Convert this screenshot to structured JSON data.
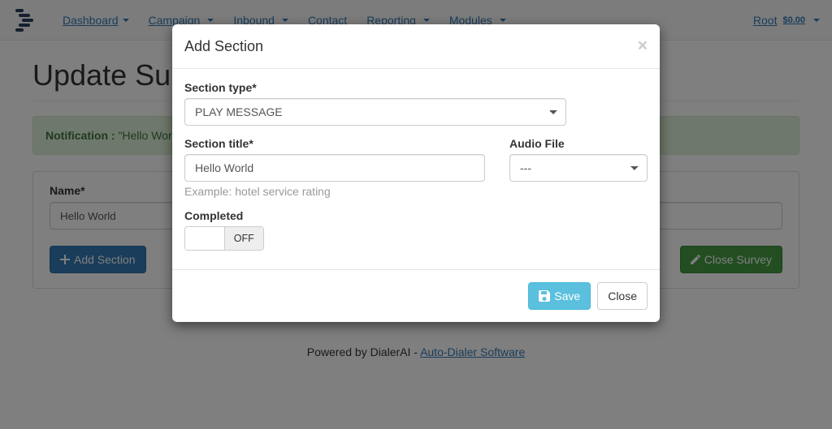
{
  "nav": {
    "items": [
      {
        "label": "Dashboard",
        "caret": true,
        "tight": true
      },
      {
        "label": "Campaign",
        "caret": true
      },
      {
        "label": "Inbound",
        "caret": true
      },
      {
        "label": "Contact",
        "caret": false
      },
      {
        "label": "Reporting",
        "caret": true
      },
      {
        "label": "Modules",
        "caret": true
      }
    ],
    "user": "Root",
    "balance": "$0.00"
  },
  "page": {
    "title": "Update Survey",
    "notification_label": "Notification : ",
    "notification_text": "\"Hello World\"",
    "name_label": "Name*",
    "name_value": "Hello World",
    "add_section_btn": "Add Section",
    "close_survey_btn": "Close Survey"
  },
  "footer": {
    "text1": "Powered by DialerAI - ",
    "link": "Auto-Dialer Software"
  },
  "modal": {
    "title": "Add Section",
    "section_type_label": "Section type*",
    "section_type_value": "PLAY MESSAGE",
    "section_title_label": "Section title*",
    "section_title_value": "Hello World",
    "section_title_help": "Example: hotel service rating",
    "audio_file_label": "Audio File",
    "audio_file_value": "---",
    "completed_label": "Completed",
    "completed_off": "OFF",
    "save_btn": "Save",
    "close_btn": "Close"
  }
}
